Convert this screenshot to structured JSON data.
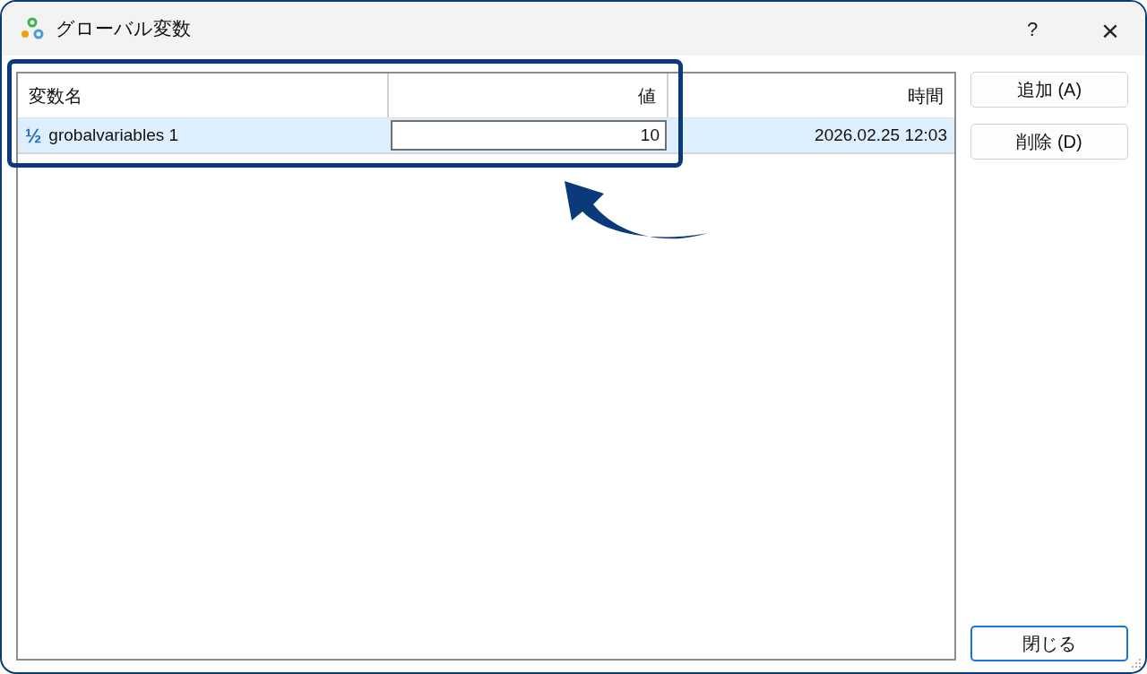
{
  "window": {
    "title": "グローバル変数",
    "help": "?",
    "close": "×"
  },
  "table": {
    "columns": [
      {
        "label": "変数名"
      },
      {
        "label": "値"
      },
      {
        "label": "時間"
      }
    ],
    "rows": [
      {
        "type_icon": "½",
        "name": "grobalvariables 1",
        "value": "10",
        "editing": true,
        "time": "2026.02.25 12:03",
        "selected": true
      }
    ]
  },
  "buttons": [
    {
      "label": "追加 (A)",
      "default": false
    },
    {
      "label": "削除 (D)",
      "default": false
    }
  ],
  "close_button": {
    "label": "閉じる",
    "default": true
  }
}
